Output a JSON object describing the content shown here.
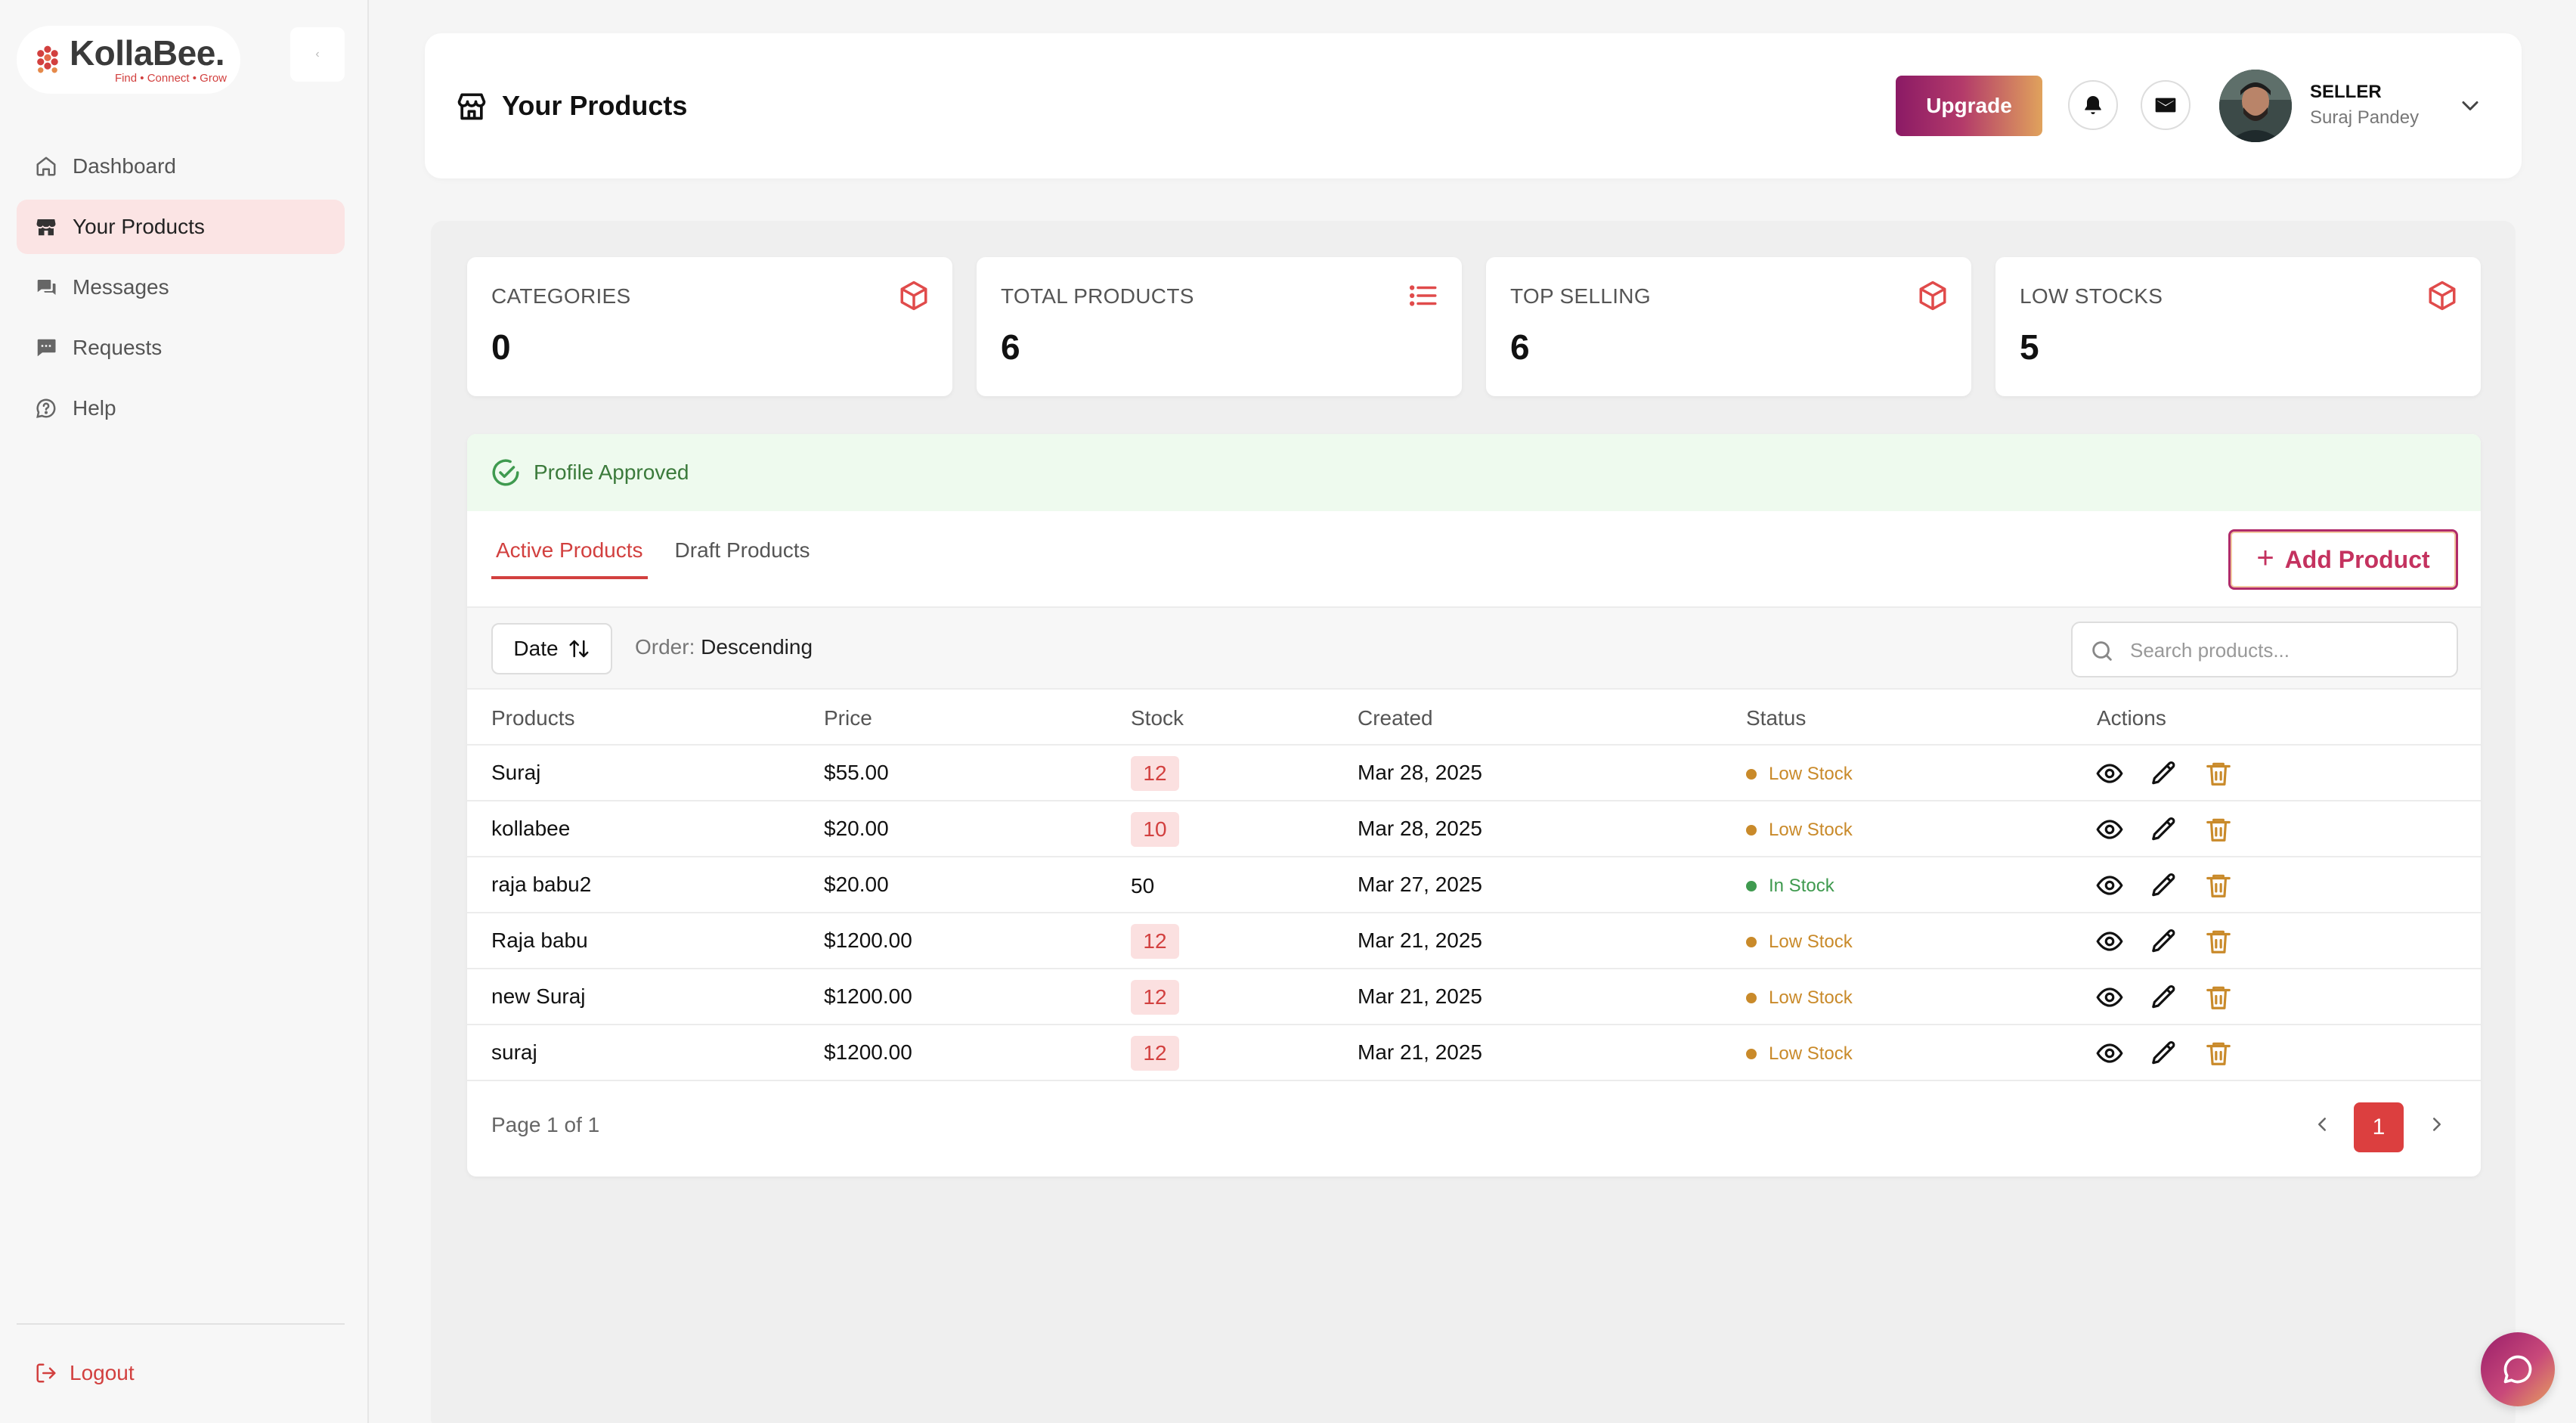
{
  "brand": {
    "name": "KollaBee.",
    "tagline": "Find • Connect • Grow",
    "primary_color": "#d2403f",
    "gradient": [
      "#8b1a65",
      "#e0a25c"
    ]
  },
  "sidebar": {
    "collapse_label": "‹",
    "items": [
      {
        "label": "Dashboard",
        "icon": "home-icon"
      },
      {
        "label": "Your Products",
        "icon": "store-icon",
        "active": true
      },
      {
        "label": "Messages",
        "icon": "chat-bubbles-icon"
      },
      {
        "label": "Requests",
        "icon": "message-square-icon"
      },
      {
        "label": "Help",
        "icon": "help-circle-icon"
      }
    ],
    "logout_label": "Logout"
  },
  "header": {
    "title": "Your Products",
    "upgrade_label": "Upgrade",
    "user_role": "SELLER",
    "user_name": "Suraj Pandey"
  },
  "stats": [
    {
      "label": "CATEGORIES",
      "value": "0",
      "icon": "box-icon"
    },
    {
      "label": "TOTAL PRODUCTS",
      "value": "6",
      "icon": "list-icon"
    },
    {
      "label": "TOP SELLING",
      "value": "6",
      "icon": "box-icon"
    },
    {
      "label": "LOW STOCKS",
      "value": "5",
      "icon": "box-icon"
    }
  ],
  "products": {
    "approved_label": "Profile Approved",
    "tabs": [
      {
        "label": "Active Products",
        "active": true
      },
      {
        "label": "Draft Products",
        "active": false
      }
    ],
    "add_product_label": "Add Product",
    "sort_label": "Date",
    "order_prefix": "Order:",
    "order_value": "Descending",
    "search_placeholder": "Search products...",
    "columns": [
      "Products",
      "Price",
      "Stock",
      "Created",
      "Status",
      "Actions"
    ],
    "rows": [
      {
        "name": "Suraj",
        "price": "$55.00",
        "stock": "12",
        "low": true,
        "created": "Mar 28, 2025",
        "status": "Low Stock"
      },
      {
        "name": "kollabee",
        "price": "$20.00",
        "stock": "10",
        "low": true,
        "created": "Mar 28, 2025",
        "status": "Low Stock"
      },
      {
        "name": "raja babu2",
        "price": "$20.00",
        "stock": "50",
        "low": false,
        "created": "Mar 27, 2025",
        "status": "In Stock"
      },
      {
        "name": "Raja babu",
        "price": "$1200.00",
        "stock": "12",
        "low": true,
        "created": "Mar 21, 2025",
        "status": "Low Stock"
      },
      {
        "name": "new Suraj",
        "price": "$1200.00",
        "stock": "12",
        "low": true,
        "created": "Mar 21, 2025",
        "status": "Low Stock"
      },
      {
        "name": "suraj",
        "price": "$1200.00",
        "stock": "12",
        "low": true,
        "created": "Mar 21, 2025",
        "status": "Low Stock"
      }
    ],
    "status_colors": {
      "Low Stock": "#c98a2a",
      "In Stock": "#3f9a4f"
    },
    "page_info": "Page 1 of 1",
    "current_page": "1"
  }
}
